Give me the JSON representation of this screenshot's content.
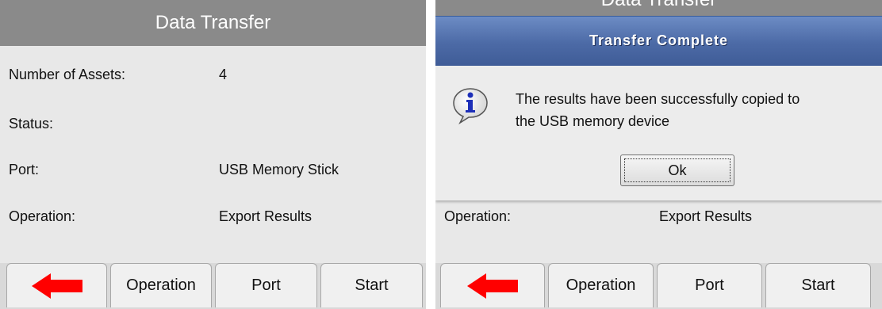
{
  "left_screen": {
    "title": "Data Transfer",
    "fields": [
      {
        "label": "Number of Assets:",
        "value": "4"
      },
      {
        "label": "Status:",
        "value": ""
      },
      {
        "label": "Port:",
        "value": "USB Memory Stick"
      },
      {
        "label": "Operation:",
        "value": "Export Results"
      }
    ],
    "toolbar": {
      "back_icon": "red-left-arrow",
      "buttons": [
        "Operation",
        "Port",
        "Start"
      ]
    }
  },
  "right_screen": {
    "title_partial": "Data Transfer",
    "dialog": {
      "title": "Transfer Complete",
      "icon": "info-speech-bubble",
      "message_line1": "The results have been successfully copied to",
      "message_line2": "the USB memory device",
      "ok_label": "Ok"
    },
    "fields": [
      {
        "label": "Operation:",
        "value": "Export Results"
      }
    ],
    "toolbar": {
      "back_icon": "red-left-arrow",
      "buttons": [
        "Operation",
        "Port",
        "Start"
      ]
    }
  },
  "colors": {
    "title_bar": "#8a8a8a",
    "dialog_header": "#4c6aa6",
    "back_arrow": "#ff0000",
    "background": "#e8e8e8"
  }
}
